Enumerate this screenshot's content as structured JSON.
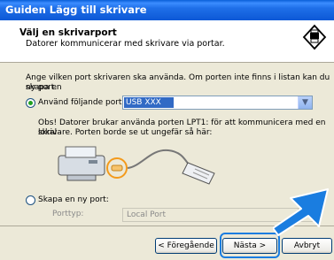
{
  "window": {
    "title": "Guiden Lägg till skrivare"
  },
  "header": {
    "title": "Välj en skrivarport",
    "subtitle": "Datorer kommunicerar med skrivare via portar.",
    "icon": "printer-badge-icon"
  },
  "intro": {
    "line1": "Ange vilken port skrivaren ska använda. Om porten inte finns i listan kan du skapa en",
    "line2": "ny port."
  },
  "existing_port": {
    "label": "Använd följande port:",
    "selected": true,
    "value": "USB XXX"
  },
  "note": {
    "line1": "Obs! Datorer brukar använda porten LPT1: för att kommunicera med en lokal",
    "line2": "skrivare. Porten borde se ut ungefär så här:"
  },
  "new_port": {
    "label": "Skapa en ny port:",
    "selected": false,
    "type_label": "Porttyp:",
    "type_value": "Local Port"
  },
  "buttons": {
    "back": "< Föregående",
    "next": "Nästa >",
    "cancel": "Avbryt"
  },
  "colors": {
    "title_bar": "#0c58d6",
    "selection": "#316ac5",
    "annotation_arrow": "#1a7de0"
  }
}
